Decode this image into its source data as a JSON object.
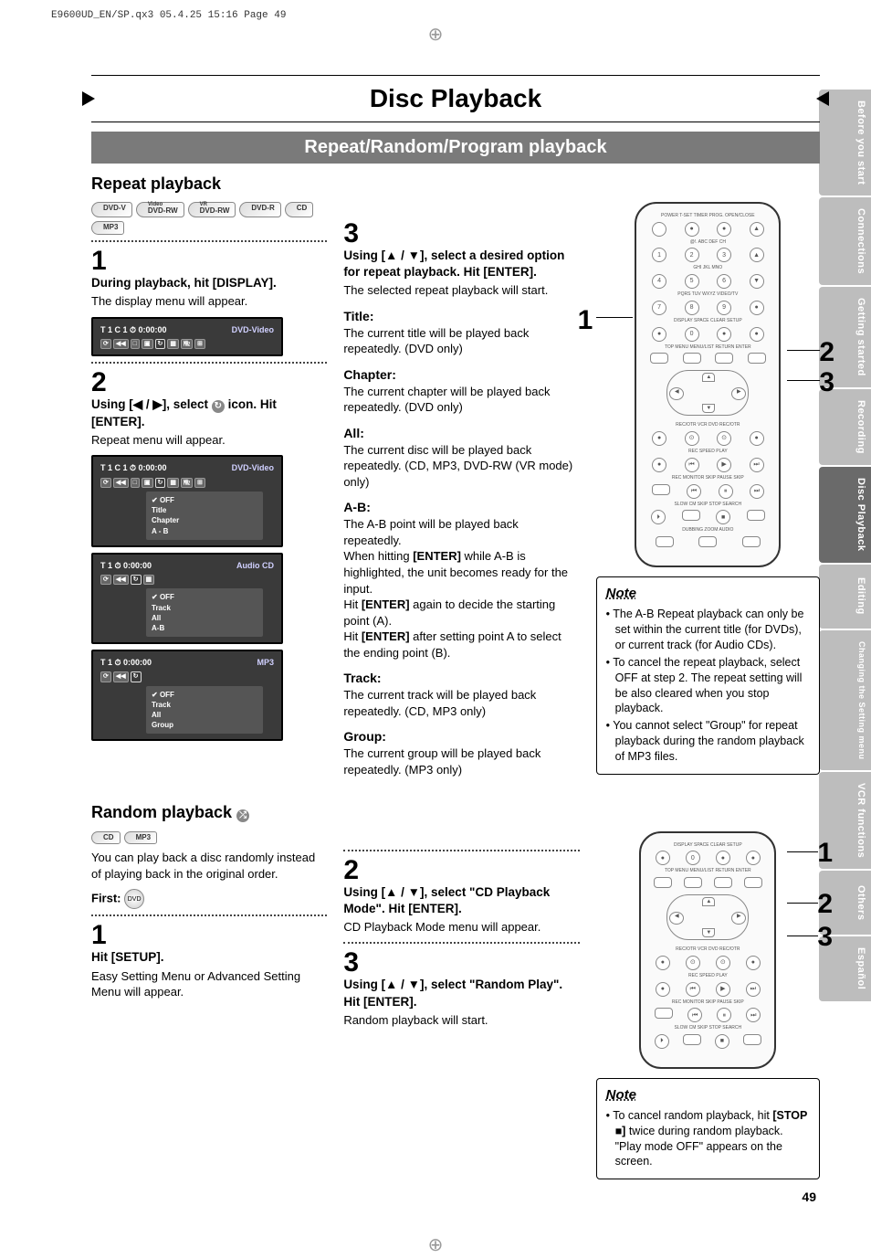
{
  "print_header": "E9600UD_EN/SP.qx3  05.4.25 15:16  Page 49",
  "title": "Disc Playback",
  "subtitle": "Repeat/Random/Program playback",
  "side_tabs": [
    {
      "label": "Before you start",
      "active": false
    },
    {
      "label": "Connections",
      "active": false
    },
    {
      "label": "Getting started",
      "active": false
    },
    {
      "label": "Recording",
      "active": false
    },
    {
      "label": "Disc Playback",
      "active": true
    },
    {
      "label": "Editing",
      "active": false
    },
    {
      "label": "Changing the Setting menu",
      "active": false,
      "small": true
    },
    {
      "label": "VCR functions",
      "active": false
    },
    {
      "label": "Others",
      "active": false
    },
    {
      "label": "Español",
      "active": false
    }
  ],
  "repeat": {
    "heading": "Repeat playback",
    "badges": [
      "DVD-V",
      "DVD-RW",
      "DVD-RW",
      "DVD-R",
      "CD",
      "MP3"
    ],
    "badge_sup": {
      "1": "Video",
      "2": "VR"
    },
    "step1": {
      "num": "1",
      "head": "During playback, hit [DISPLAY].",
      "body": "The display menu will appear.",
      "osd": {
        "info": "T  1   C  1   ⏱ 0:00:00",
        "media": "DVD-Video"
      }
    },
    "step2": {
      "num": "2",
      "head_pre": "Using [◀ / ▶], select ",
      "head_post": " icon. Hit [ENTER].",
      "icon_label": "↻",
      "body": "Repeat menu will appear.",
      "osd1": {
        "info": "T  1   C  1   ⏱ 0:00:00",
        "media": "DVD-Video",
        "menu": [
          "OFF",
          "Title",
          "Chapter",
          "A - B"
        ]
      },
      "osd2": {
        "info": "T  1        ⏱ 0:00:00",
        "media": "Audio CD",
        "menu": [
          "OFF",
          "Track",
          "All",
          "A-B"
        ]
      },
      "osd3": {
        "info": "T  1        ⏱ 0:00:00",
        "media": "MP3",
        "menu": [
          "OFF",
          "Track",
          "All",
          "Group"
        ]
      }
    },
    "step3": {
      "num": "3",
      "head": "Using [▲ / ▼], select a desired option for repeat playback. Hit [ENTER].",
      "body": "The selected repeat playback will start.",
      "opts": [
        {
          "h": "Title:",
          "b": "The current title will be played back repeatedly. (DVD only)"
        },
        {
          "h": "Chapter:",
          "b": "The current chapter will be played back repeatedly. (DVD only)"
        },
        {
          "h": "All:",
          "b": "The current disc will be played back repeatedly. (CD, MP3, DVD-RW (VR mode) only)"
        },
        {
          "h": "A-B:",
          "b": "The A-B point will be played back repeatedly.\nWhen hitting [ENTER] while A-B is highlighted, the unit becomes ready for the input.\nHit [ENTER] again to decide the starting point (A).\nHit [ENTER] after setting point A to select the ending point (B)."
        },
        {
          "h": "Track:",
          "b": "The current track will be played back repeatedly. (CD, MP3 only)"
        },
        {
          "h": "Group:",
          "b": "The current group will be played back repeatedly. (MP3 only)"
        }
      ]
    },
    "remote_callouts": [
      "1",
      "2",
      "3"
    ],
    "note_title": "Note",
    "notes": [
      "The A-B Repeat playback can only be set within the current title (for DVDs), or current track (for Audio CDs).",
      "To cancel the repeat playback, select OFF at step 2. The repeat setting will be also cleared when you stop playback.",
      "You cannot select \"Group\" for repeat playback during the random playback of MP3 files."
    ]
  },
  "random": {
    "heading": "Random playback",
    "heading_icon": "⤮",
    "badges": [
      "CD",
      "MP3"
    ],
    "intro": "You can play back a disc randomly instead of playing back in the original order.",
    "first_label": "First:",
    "step1": {
      "num": "1",
      "head": "Hit [SETUP].",
      "body": "Easy Setting Menu or Advanced Setting Menu will appear."
    },
    "step2": {
      "num": "2",
      "head": "Using [▲ / ▼], select \"CD Playback Mode\". Hit [ENTER].",
      "body": "CD Playback Mode menu will appear."
    },
    "step3": {
      "num": "3",
      "head": "Using [▲ / ▼], select \"Random Play\". Hit [ENTER].",
      "body": "Random playback will start."
    },
    "remote_callouts": [
      "1",
      "2",
      "3"
    ],
    "note_title": "Note",
    "notes": [
      "To cancel random playback, hit [STOP ■] twice during random playback. \"Play mode OFF\" appears on the screen."
    ]
  },
  "remote_labels": {
    "row0": "POWER   T-SET   TIMER PROG.   OPEN/CLOSE",
    "row1": "@!.   ABC   DEF   CH",
    "row2": "GHI   JKL   MNO",
    "row3": "PQRS   TUV   WXYZ   VIDEO/TV",
    "row4": "DISPLAY   SPACE   CLEAR   SETUP",
    "row5": "TOP MENU   MENU/LIST   RETURN   ENTER",
    "row6": "REC/OTR   VCR   DVD   REC/OTR",
    "row7": "REC SPEED               PLAY",
    "row8": "REC MONITOR   SKIP   PAUSE   SKIP",
    "row9": "SLOW   CM SKIP   STOP   SEARCH",
    "row10": "DUBBING   ZOOM   AUDIO"
  },
  "page_number": "49"
}
